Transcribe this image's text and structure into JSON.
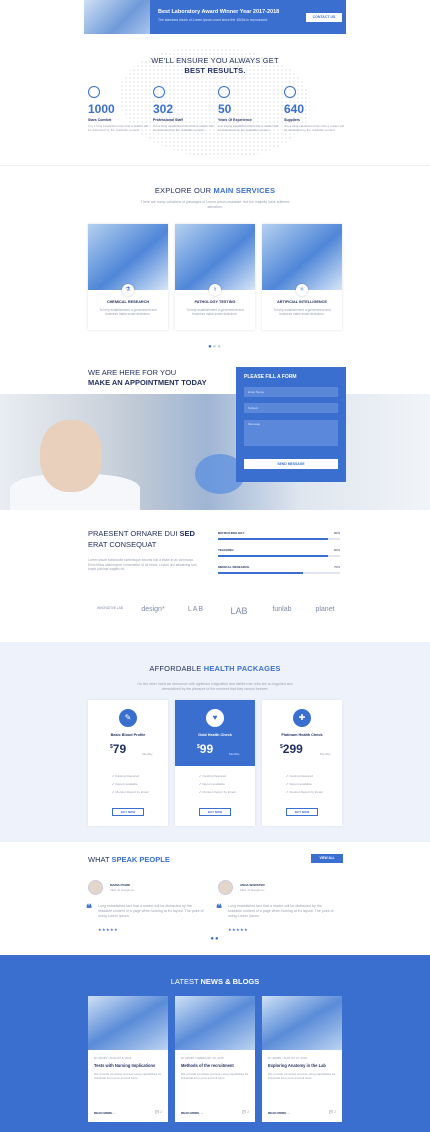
{
  "award": {
    "title": "Best Laboratory Award Winner Year 2017-2018",
    "text": "The standard chunk of Lorem Ipsum used since the 1500s is reproduced.",
    "button": "CONTACT US"
  },
  "results": {
    "heading_line1": "WE'LL ENSURE YOU ALWAYS GET",
    "heading_line2": "BEST RESULTS.",
    "stats": [
      {
        "icon": "clipboard-icon",
        "number": "1000",
        "label": "Stars Comfort",
        "text": "It is a long established fact that a reader will be distracted by the readable content."
      },
      {
        "icon": "doctor-icon",
        "number": "302",
        "label": "Professional Staff",
        "text": "It is a long established fact that a reader will be distracted by the readable content."
      },
      {
        "icon": "medal-icon",
        "number": "50",
        "label": "Years Of Experience",
        "text": "It is a long established fact that a reader will be distracted by the readable content."
      },
      {
        "icon": "flask-icon",
        "number": "640",
        "label": "Suppliers",
        "text": "It is a long established fact that a reader will be distracted by the readable content."
      }
    ]
  },
  "services": {
    "heading_light": "EXPLORE OUR ",
    "heading_bold": "MAIN SERVICES",
    "sub": "There are many variations of passages of Lorem Ipsum available, but the majority have suffered alteration.",
    "cards": [
      {
        "title": "CHEMICAL RESEARCH",
        "text": "To help establishment a government and business make smart decisions."
      },
      {
        "title": "PATHOLOGY TESTING",
        "text": "To help establishment a government and business make smart decisions."
      },
      {
        "title": "ARTIFICIAL INTELLIGENCE",
        "text": "To help establishment a government and business make smart decisions."
      }
    ]
  },
  "appointment": {
    "line1": "WE ARE HERE FOR YOU",
    "line2": "MAKE AN APPOINTMENT TODAY",
    "form_title": "PLEASE FILL A FORM",
    "name_placeholder": "Enter Name",
    "subject_placeholder": "Subject",
    "message_placeholder": "Message",
    "send": "SEND MESSAGE"
  },
  "skills": {
    "heading_line1_light": "PRAESENT ORNARE DUI ",
    "heading_line1_bold": "SED",
    "heading_line2": "ERAT CONSEQUAT",
    "text": "Lorem ipsum sollicitudin scelerisque lobortis nisl a etiam in ac commodo. Enim tellus ullamcorper consectetur ut ult netus. Luctus nisi adipiscing sed turpis pulvinar sagittis mi.",
    "bars": [
      {
        "label": "BIOTECHNOLOGY",
        "value": 90,
        "display": "90%"
      },
      {
        "label": "TEACHING",
        "value": 90,
        "display": "90%"
      },
      {
        "label": "MEDICAL RESEARCH",
        "value": 70,
        "display": "70%"
      }
    ],
    "logos": [
      "INNOVATIVE LAB",
      "design*",
      "LAB",
      "LAB",
      "funlab",
      "planet"
    ]
  },
  "packages": {
    "heading_light": "AFFORDABLE ",
    "heading_bold": "HEALTH PACKAGES",
    "sub": "On the other hand we denounce with righteous indignation and dislike men who are so beguiled and demoralized by the pleasure of the moment that they cannot foresee.",
    "plans": [
      {
        "name": "Basic Blood Profile",
        "currency": "$",
        "price": "79",
        "period": "Monthly",
        "features": [
          "Fasting Required",
          "Report available",
          "Monitor Report by Email"
        ],
        "button": "BUY NOW"
      },
      {
        "name": "Gold Health Check",
        "currency": "$",
        "price": "99",
        "period": "Monthly",
        "features": [
          "Fasting Required",
          "Report available",
          "Monitor Report by Email"
        ],
        "button": "BUY NOW"
      },
      {
        "name": "Platinum Health Check",
        "currency": "$",
        "price": "299",
        "period": "Monthly",
        "features": [
          "Fasting Required",
          "Report available",
          "Monitor Report by Email"
        ],
        "button": "BUY NOW"
      }
    ]
  },
  "testimonials": {
    "heading_light": "WHAT ",
    "heading_bold": "SPEAK PEOPLE",
    "view_all": "VIEW ALL",
    "items": [
      {
        "name": "MARIA POHRI",
        "role": "CEO, AI Google Inc",
        "quote": "Long established fact that a reader will be distracted by the readable content of a page when looking at it's layout. The point of using Lorem Ipsum.",
        "stars": "★★★★★"
      },
      {
        "name": "ANNA WORSTER",
        "role": "CEO, AI Google Inc",
        "quote": "Long established fact that a reader will be distracted by the readable content of a page when looking at it's layout. The point of using Lorem Ipsum.",
        "stars": "★★★★★"
      }
    ]
  },
  "news": {
    "heading_light": "LATEST ",
    "heading_bold": "NEWS & BLOGS",
    "posts": [
      {
        "meta": "BY ADMIN / AUGUST 8, 2018",
        "title": "Tests with Nursing Implications",
        "text": "We provide complete process using capabilities for industrial from pure and full fonts.",
        "read": "READ MORE →",
        "comments": "💬 2"
      },
      {
        "meta": "BY ADMIN / FEBRUARY 19, 2018",
        "title": "Methods of the recruitment",
        "text": "We provide complete process using capabilities for industrial from pure and full fonts.",
        "read": "READ MORE →",
        "comments": "💬 2"
      },
      {
        "meta": "BY ADMIN / AUGUST 27, 2018",
        "title": "Exploring Anatomy in the Lab",
        "text": "We provide complete process using capabilities for industrial from pure and full fonts.",
        "read": "READ MORE →",
        "comments": "💬 2"
      }
    ]
  },
  "colors": {
    "accent": "#3a6fd0",
    "navy": "#1f2d5c",
    "muted": "#9aa2b0",
    "light_bg": "#eef3fb"
  }
}
